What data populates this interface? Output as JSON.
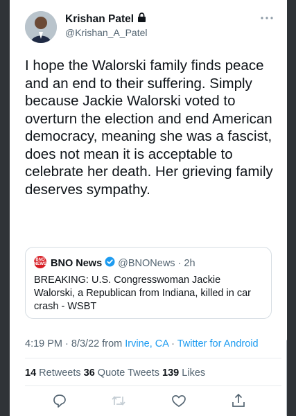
{
  "author": {
    "name": "Krishan Patel",
    "handle": "@Krishan_A_Patel"
  },
  "tweet": {
    "text": "I hope the Walorski family finds peace and an end to their suffering. Simply because Jackie Walorski voted to overturn the election and end American democracy, meaning she was a fascist, does not mean it is acceptable to celebrate her death. Her grieving family deserves sympathy."
  },
  "quoted_tweet": {
    "logo_text_top": "BNO",
    "logo_text_bottom": "NEWS",
    "name": "BNO News",
    "handle_time": "@BNONews · 2h",
    "text": "BREAKING: U.S. Congresswoman Jackie Walorski, a Republican from Indiana, killed in car crash - WSBT"
  },
  "meta": {
    "time_date": "4:19 PM · 8/3/22 from ",
    "location": "Irvine, CA",
    "separator": " · ",
    "source": "Twitter for Android"
  },
  "stats": {
    "retweets_count": "14",
    "retweets_label": " Retweets ",
    "quotes_count": "36",
    "quotes_label": " Quote Tweets ",
    "likes_count": "139",
    "likes_label": " Likes"
  },
  "colors": {
    "link": "#1d9bf0",
    "verified": "#1d9bf0",
    "bno_red": "#d71d24"
  },
  "icons": [
    "lock-icon",
    "more-icon",
    "verified-icon",
    "reply-icon",
    "retweet-icon",
    "like-icon",
    "share-icon"
  ]
}
